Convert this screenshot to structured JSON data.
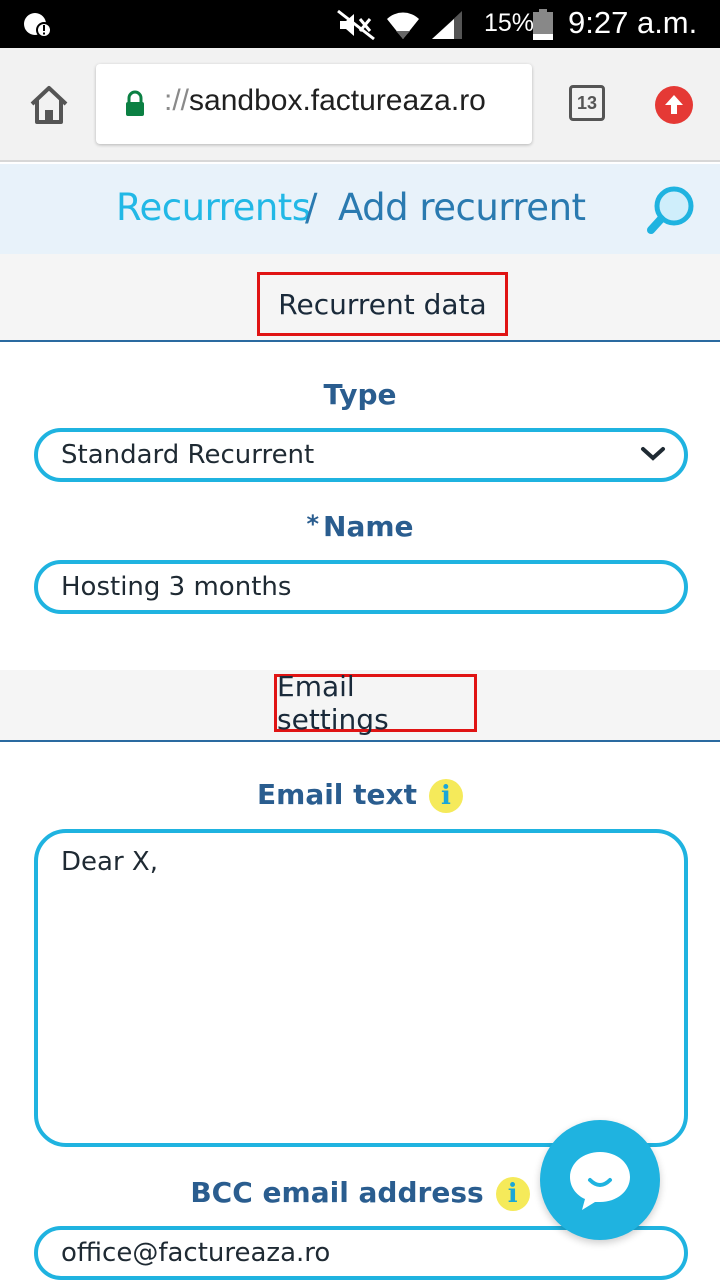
{
  "status_bar": {
    "battery_percent": "15%",
    "time": "9:27 a.m."
  },
  "browser": {
    "url_scheme": "://",
    "url_host": "sandbox.factureaza.ro",
    "tab_count": "13"
  },
  "breadcrumb": {
    "parent": "Recurrents",
    "separator": "/",
    "current": "Add recurrent"
  },
  "sections": {
    "recurrent_data": "Recurrent data",
    "email_settings": "Email settings"
  },
  "form": {
    "type_label": "Type",
    "type_value": "Standard Recurrent",
    "name_required_mark": "*",
    "name_label": "Name",
    "name_value": "Hosting 3 months",
    "email_text_label": "Email text",
    "email_text_value": "Dear X,",
    "bcc_label": "BCC email address",
    "bcc_value": "office@factureaza.ro",
    "info_glyph": "i"
  },
  "colors": {
    "accent": "#1fb3e0",
    "label": "#2a5d8f",
    "highlight_border": "#e01414",
    "info_badge": "#f5ea5a"
  },
  "icons": [
    "alert-icon",
    "mute-icon",
    "wifi-icon",
    "signal-icon",
    "battery-icon",
    "home-icon",
    "lock-icon",
    "tabs-icon",
    "update-icon",
    "search-icon",
    "chevron-down-icon",
    "info-icon",
    "chat-icon"
  ]
}
